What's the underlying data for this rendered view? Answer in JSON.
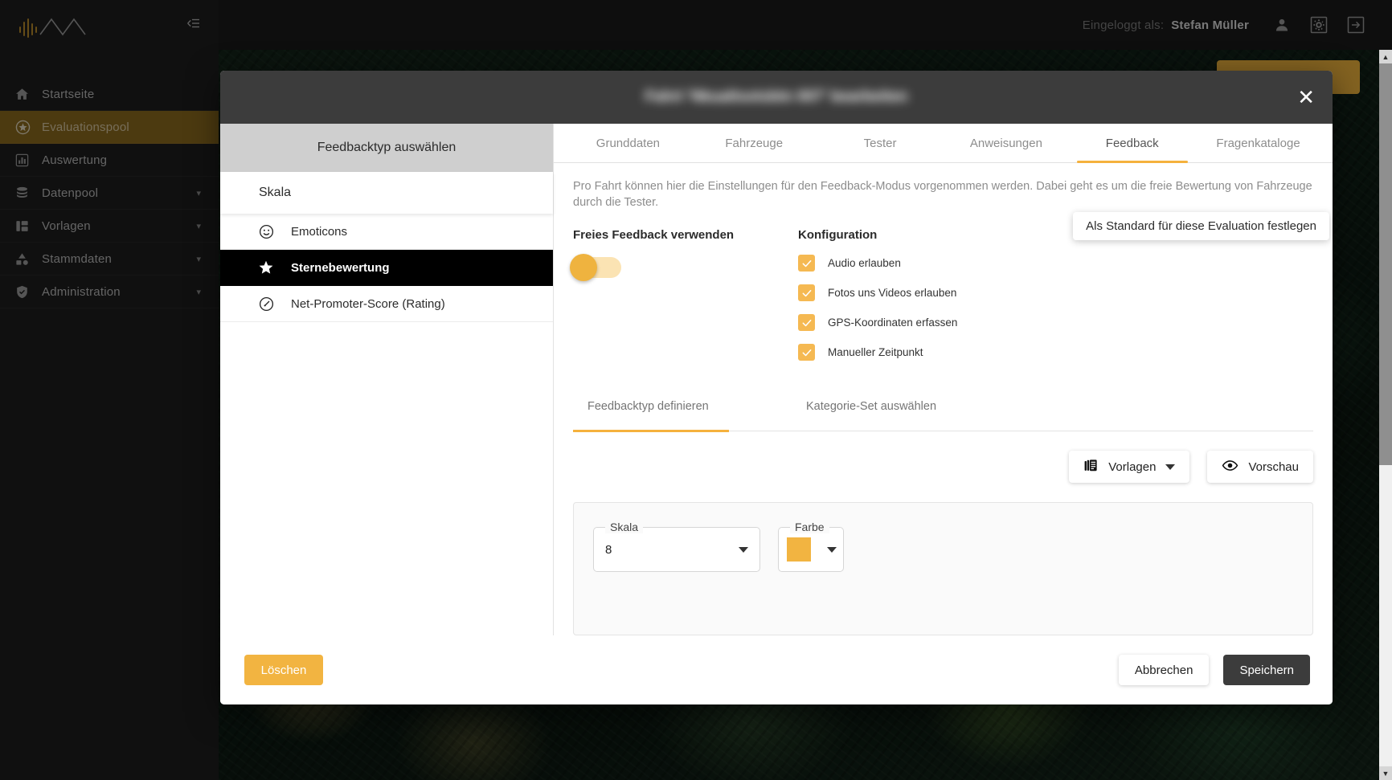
{
  "topbar": {
    "logged_in_label": "Eingeloggt als:",
    "user_name": "Stefan Müller",
    "icons": [
      "user-icon",
      "settings-gear-icon",
      "logout-icon"
    ]
  },
  "sidebar": {
    "logo_name": "iva-logo",
    "collapse_icon": "collapse-sidebar-icon",
    "items": [
      {
        "label": "Startseite",
        "icon": "home-icon",
        "active": false,
        "expandable": false
      },
      {
        "label": "Evaluationspool",
        "icon": "star-circle-icon",
        "active": true,
        "expandable": false
      },
      {
        "label": "Auswertung",
        "icon": "bar-chart-icon",
        "active": false,
        "expandable": false
      },
      {
        "label": "Datenpool",
        "icon": "database-icon",
        "active": false,
        "expandable": true
      },
      {
        "label": "Vorlagen",
        "icon": "layout-icon",
        "active": false,
        "expandable": true
      },
      {
        "label": "Stammdaten",
        "icon": "shapes-icon",
        "active": false,
        "expandable": true
      },
      {
        "label": "Administration",
        "icon": "shield-check-icon",
        "active": false,
        "expandable": true
      }
    ]
  },
  "modal": {
    "title": "Fahrt 'Nkualtsotsbtn 007' bearbeiten",
    "close_icon": "close-icon",
    "left_panel": {
      "header": "Feedbacktyp auswählen",
      "group_title": "Skala",
      "items": [
        {
          "label": "Emoticons",
          "icon": "smiley-icon",
          "selected": false
        },
        {
          "label": "Sternebewertung",
          "icon": "star-icon",
          "selected": true
        },
        {
          "label": "Net-Promoter-Score (Rating)",
          "icon": "gauge-icon",
          "selected": false
        }
      ]
    },
    "tabs": [
      {
        "label": "Grunddaten",
        "active": false
      },
      {
        "label": "Fahrzeuge",
        "active": false
      },
      {
        "label": "Tester",
        "active": false
      },
      {
        "label": "Anweisungen",
        "active": false
      },
      {
        "label": "Feedback",
        "active": true
      },
      {
        "label": "Fragenkataloge",
        "active": false
      }
    ],
    "intro": "Pro Fahrt können hier die Einstellungen für den Feedback-Modus vorgenommen werden. Dabei geht es um die freie Bewertung von Fahrzeuge durch die Tester.",
    "freies_feedback": {
      "title": "Freies Feedback verwenden",
      "toggle_state": "off"
    },
    "konfiguration": {
      "title": "Konfiguration",
      "checkboxes": [
        {
          "label": "Audio erlauben",
          "checked": true
        },
        {
          "label": "Fotos uns Videos erlauben",
          "checked": true
        },
        {
          "label": "GPS-Koordinaten erfassen",
          "checked": true
        },
        {
          "label": "Manueller Zeitpunkt",
          "checked": true
        }
      ]
    },
    "tooltip": "Als Standard für diese Evaluation festlegen",
    "subtabs": [
      {
        "label": "Feedbacktyp definieren",
        "active": true
      },
      {
        "label": "Kategorie-Set auswählen",
        "active": false
      }
    ],
    "tools": [
      {
        "label": "Vorlagen",
        "icon": "templates-icon",
        "has_caret": true
      },
      {
        "label": "Vorschau",
        "icon": "eye-icon",
        "has_caret": false
      }
    ],
    "editor": {
      "skala_legend": "Skala",
      "skala_value": "8",
      "farbe_legend": "Farbe",
      "farbe_value": "#f2b441"
    },
    "footer": {
      "delete_label": "Löschen",
      "cancel_label": "Abbrechen",
      "save_label": "Speichern"
    }
  },
  "scrollbar": {
    "up_arrow": "chevron-up-icon",
    "down_arrow": "chevron-down-icon"
  },
  "colors": {
    "accent": "#f2b441",
    "sidebar_active": "#8b6a1e",
    "dark": "#3c3c3c"
  }
}
